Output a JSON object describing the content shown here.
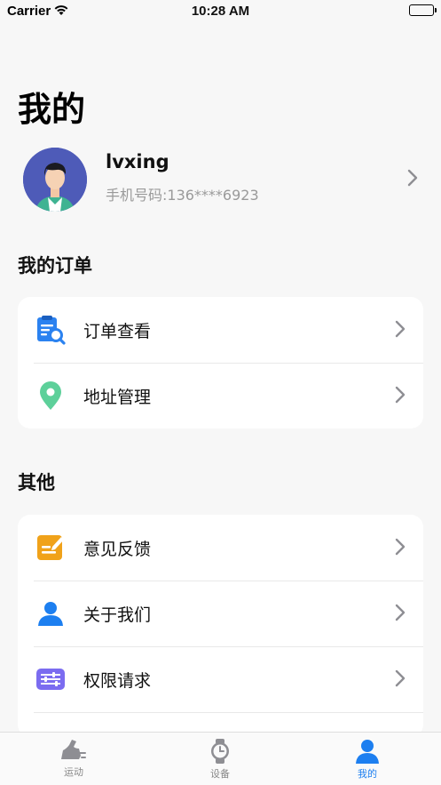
{
  "status_bar": {
    "carrier": "Carrier",
    "time": "10:28 AM"
  },
  "page_title": "我的",
  "profile": {
    "username": "lvxing",
    "phone": "手机号码:136****6923"
  },
  "orders_section": {
    "title": "我的订单",
    "items": [
      {
        "label": "订单查看",
        "icon": "order-search-icon"
      },
      {
        "label": "地址管理",
        "icon": "location-pin-icon"
      }
    ]
  },
  "other_section": {
    "title": "其他",
    "items": [
      {
        "label": "意见反馈",
        "icon": "feedback-edit-icon"
      },
      {
        "label": "关于我们",
        "icon": "person-icon"
      },
      {
        "label": "权限请求",
        "icon": "sliders-icon"
      }
    ]
  },
  "tabbar": {
    "tabs": [
      {
        "label": "运动",
        "icon": "running-shoe-icon"
      },
      {
        "label": "设备",
        "icon": "watch-icon"
      },
      {
        "label": "我的",
        "icon": "profile-icon",
        "active": true
      }
    ]
  },
  "colors": {
    "accent": "#1d7ff0",
    "background": "#f7f7f7"
  }
}
